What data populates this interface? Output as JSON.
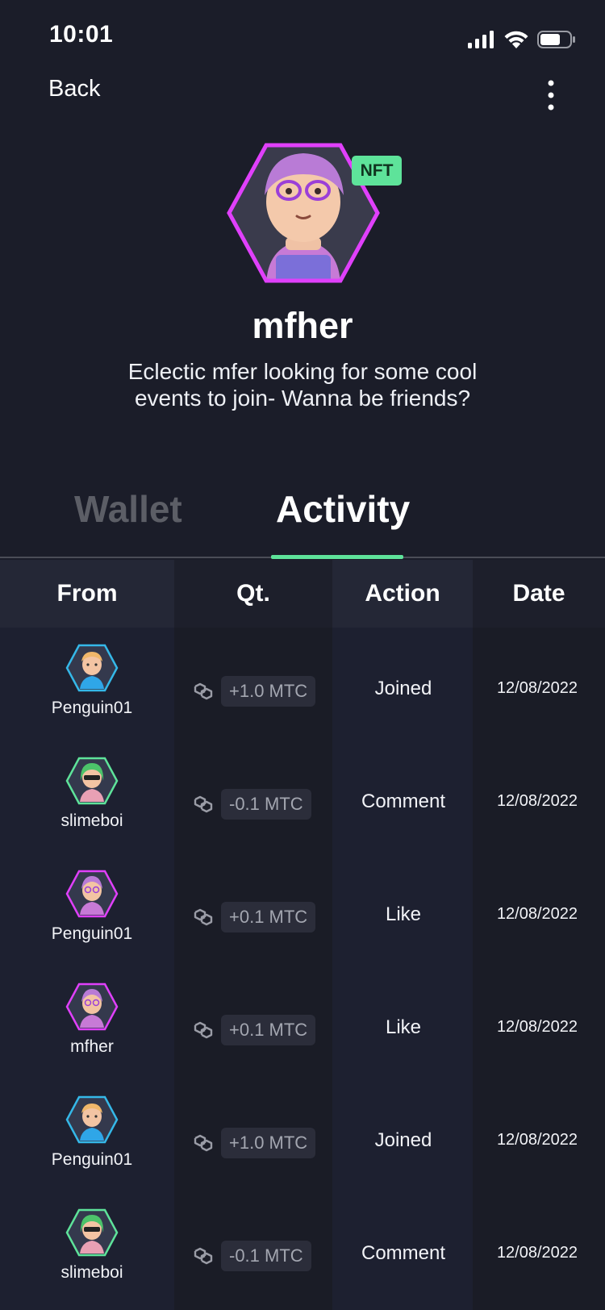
{
  "status_bar": {
    "time": "10:01"
  },
  "nav": {
    "back_label": "Back"
  },
  "profile": {
    "badge": "NFT",
    "name": "mfher",
    "bio": "Eclectic mfer looking for some cool events to join- Wanna be friends?"
  },
  "tabs": [
    {
      "label": "Wallet",
      "active": false
    },
    {
      "label": "Activity",
      "active": true
    }
  ],
  "colors": {
    "accent": "#5ee39a",
    "hex_pink": "#e040fb",
    "hex_blue": "#35b8e8",
    "hex_green": "#5ee39a"
  },
  "table": {
    "headers": {
      "from": "From",
      "qt": "Qt.",
      "action": "Action",
      "date": "Date"
    },
    "rows": [
      {
        "from": "Penguin01",
        "avatar": "penguin-avatar",
        "qty": "+1.0 MTC",
        "action": "Joined",
        "date": "12/08/2022"
      },
      {
        "from": "slimeboi",
        "avatar": "slimeboi-avatar",
        "qty": "-0.1 MTC",
        "action": "Comment",
        "date": "12/08/2022"
      },
      {
        "from": "Penguin01",
        "avatar": "mfher-avatar",
        "qty": "+0.1 MTC",
        "action": "Like",
        "date": "12/08/2022"
      },
      {
        "from": "mfher",
        "avatar": "mfher-avatar",
        "qty": "+0.1 MTC",
        "action": "Like",
        "date": "12/08/2022"
      },
      {
        "from": "Penguin01",
        "avatar": "penguin-avatar",
        "qty": "+1.0 MTC",
        "action": "Joined",
        "date": "12/08/2022"
      },
      {
        "from": "slimeboi",
        "avatar": "slimeboi-avatar",
        "qty": "-0.1 MTC",
        "action": "Comment",
        "date": "12/08/2022"
      }
    ]
  }
}
